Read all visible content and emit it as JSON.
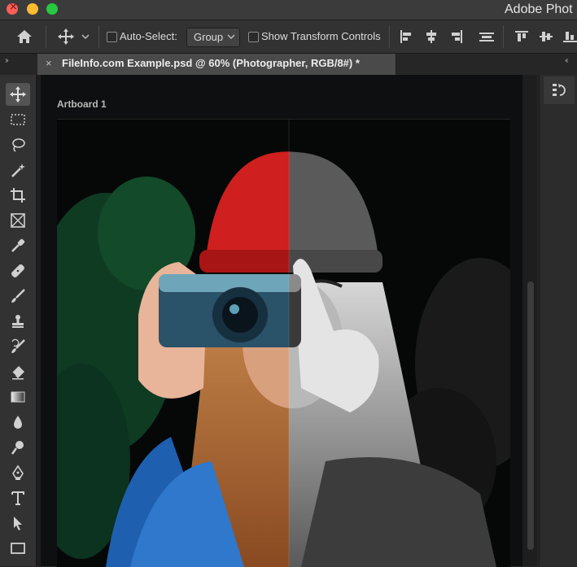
{
  "window": {
    "app_title": "Adobe Phot",
    "controls": [
      "close",
      "minimize",
      "zoom"
    ]
  },
  "options_bar": {
    "home_icon": "home-icon",
    "move_icon": "move-tool-icon",
    "auto_select_label": "Auto-Select:",
    "auto_select_checked": false,
    "auto_select_value": "Group",
    "show_transform_label": "Show Transform Controls",
    "show_transform_checked": false,
    "align_icons": [
      "align-left-edges-icon",
      "align-horizontal-centers-icon",
      "align-right-edges-icon",
      "distribute-icon",
      "align-top-edges-icon",
      "align-vertical-centers-icon",
      "align-bottom-edges-icon"
    ]
  },
  "panel_collapse": {
    "left": "››",
    "right": "‹‹"
  },
  "document_tab": {
    "close_glyph": "×",
    "title": "FileInfo.com Example.psd @ 60% (Photographer, RGB/8#) *"
  },
  "artboard": {
    "label": "Artboard 1",
    "image_description": "Photo of a woman holding a camera, left half in color, right half desaturated to black and white except for the red beanie"
  },
  "tools": [
    {
      "name": "move-tool",
      "active": true
    },
    {
      "name": "rectangular-marquee-tool"
    },
    {
      "name": "lasso-tool"
    },
    {
      "name": "magic-wand-tool"
    },
    {
      "name": "crop-tool"
    },
    {
      "name": "frame-tool"
    },
    {
      "name": "eyedropper-tool"
    },
    {
      "name": "spot-healing-brush-tool"
    },
    {
      "name": "brush-tool"
    },
    {
      "name": "clone-stamp-tool"
    },
    {
      "name": "history-brush-tool"
    },
    {
      "name": "eraser-tool"
    },
    {
      "name": "gradient-tool"
    },
    {
      "name": "blur-tool"
    },
    {
      "name": "dodge-tool"
    },
    {
      "name": "pen-tool"
    },
    {
      "name": "type-tool"
    },
    {
      "name": "path-selection-tool"
    },
    {
      "name": "rectangle-tool"
    }
  ],
  "right_panel": {
    "history_icon": "history-panel-icon"
  },
  "colors": {
    "window_bg": "#262626",
    "bar_bg": "#323232",
    "tab_active": "#4a4a4a",
    "canvas_bg": "#0e0f10",
    "beanie_red": "#d52a2a"
  }
}
